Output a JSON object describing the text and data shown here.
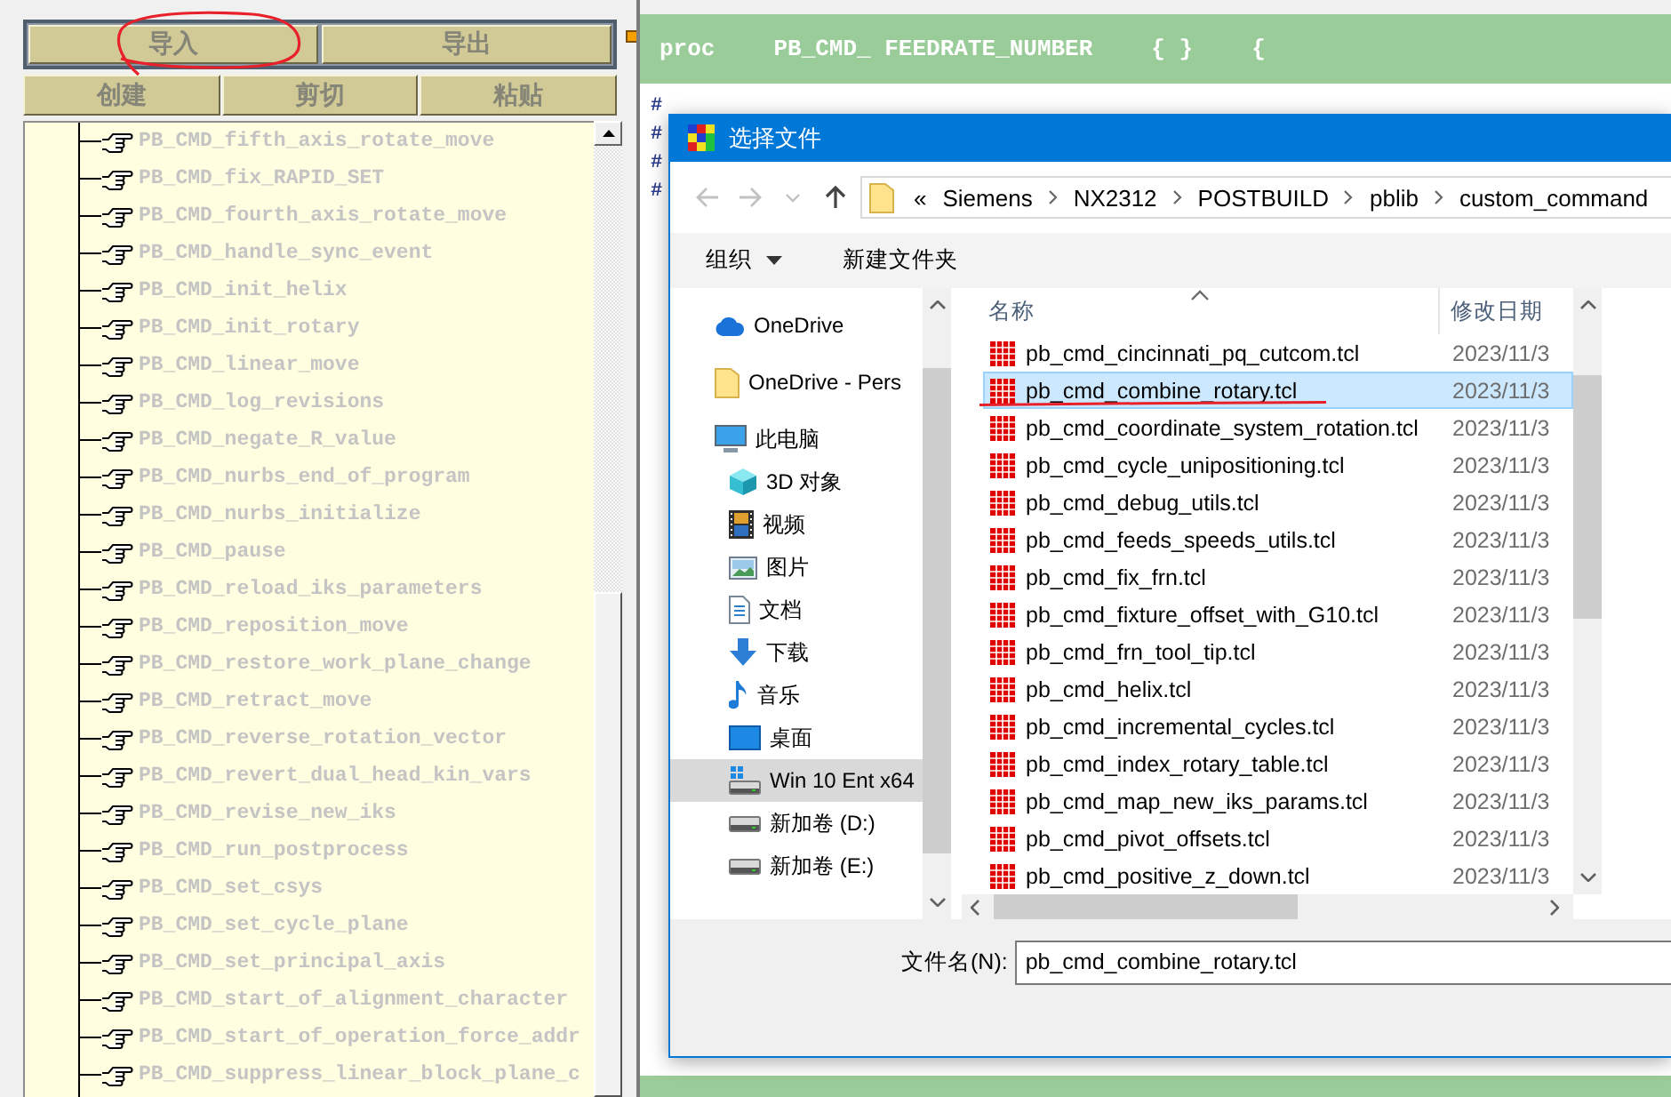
{
  "file_buttons": [
    {
      "label": "导入",
      "disabled": true,
      "marked": true
    },
    {
      "label": "导出",
      "disabled": true,
      "marked": false
    }
  ],
  "edit_buttons": [
    {
      "label": "创建",
      "disabled": true
    },
    {
      "label": "剪切",
      "disabled": true
    },
    {
      "label": "粘贴",
      "disabled": true
    }
  ],
  "command_tree": {
    "items": [
      {
        "label": "PB_CMD_fifth_axis_rotate_move",
        "disabled": true
      },
      {
        "label": "PB_CMD_fix_RAPID_SET",
        "disabled": true
      },
      {
        "label": "PB_CMD_fourth_axis_rotate_move",
        "disabled": true
      },
      {
        "label": "PB_CMD_handle_sync_event",
        "disabled": true
      },
      {
        "label": "PB_CMD_init_helix",
        "disabled": true
      },
      {
        "label": "PB_CMD_init_rotary",
        "disabled": true
      },
      {
        "label": "PB_CMD_linear_move",
        "disabled": true
      },
      {
        "label": "PB_CMD_log_revisions",
        "disabled": true
      },
      {
        "label": "PB_CMD_negate_R_value",
        "disabled": true
      },
      {
        "label": "PB_CMD_nurbs_end_of_program",
        "disabled": true
      },
      {
        "label": "PB_CMD_nurbs_initialize",
        "disabled": true
      },
      {
        "label": "PB_CMD_pause",
        "disabled": true
      },
      {
        "label": "PB_CMD_reload_iks_parameters",
        "disabled": true
      },
      {
        "label": "PB_CMD_reposition_move",
        "disabled": true
      },
      {
        "label": "PB_CMD_restore_work_plane_change",
        "disabled": true
      },
      {
        "label": "PB_CMD_retract_move",
        "disabled": true
      },
      {
        "label": "PB_CMD_reverse_rotation_vector",
        "disabled": true
      },
      {
        "label": "PB_CMD_revert_dual_head_kin_vars",
        "disabled": true
      },
      {
        "label": "PB_CMD_revise_new_iks",
        "disabled": true
      },
      {
        "label": "PB_CMD_run_postprocess",
        "disabled": true
      },
      {
        "label": "PB_CMD_set_csys",
        "disabled": true
      },
      {
        "label": "PB_CMD_set_cycle_plane",
        "disabled": true
      },
      {
        "label": "PB_CMD_set_principal_axis",
        "disabled": true
      },
      {
        "label": "PB_CMD_start_of_alignment_character",
        "disabled": true
      },
      {
        "label": "PB_CMD_start_of_operation_force_addr",
        "disabled": true
      },
      {
        "label": "PB_CMD_suppress_linear_block_plane_c",
        "disabled": true
      }
    ]
  },
  "editor": {
    "header": {
      "keyword": "proc",
      "name": "PB_CMD_ FEEDRATE_NUMBER",
      "args": "{ }",
      "body_open": "{"
    },
    "lines": [
      "#",
      "#",
      "#",
      "#"
    ]
  },
  "dialog": {
    "title": "选择文件",
    "nav_buttons": [
      {
        "kind": "back",
        "disabled": true
      },
      {
        "kind": "forward",
        "disabled": true
      },
      {
        "kind": "recent",
        "disabled": true
      },
      {
        "kind": "up",
        "disabled": false
      }
    ],
    "address": {
      "overflow": "«",
      "segments": [
        "Siemens",
        "NX2312",
        "POSTBUILD",
        "pblib",
        "custom_command"
      ]
    },
    "toolbar": [
      {
        "label": "组织",
        "kind": "menu"
      },
      {
        "label": "新建文件夹",
        "kind": "command"
      }
    ],
    "nav_items": [
      {
        "label": "OneDrive",
        "kind": "cloud",
        "selected": false
      },
      {
        "label": "OneDrive - Pers",
        "kind": "folder",
        "selected": false
      },
      {
        "label": "此电脑",
        "kind": "computer",
        "selected": false,
        "children": [
          {
            "label": "3D 对象",
            "kind": "objects_3d",
            "selected": false
          },
          {
            "label": "视频",
            "kind": "videos",
            "selected": false
          },
          {
            "label": "图片",
            "kind": "pictures",
            "selected": false
          },
          {
            "label": "文档",
            "kind": "documents",
            "selected": false
          },
          {
            "label": "下载",
            "kind": "downloads",
            "selected": false
          },
          {
            "label": "音乐",
            "kind": "music",
            "selected": false
          },
          {
            "label": "桌面",
            "kind": "desktop",
            "selected": false
          },
          {
            "label": "Win 10 Ent x64",
            "kind": "system_drive",
            "selected": true
          },
          {
            "label": "新加卷 (D:)",
            "kind": "drive",
            "selected": false
          },
          {
            "label": "新加卷 (E:)",
            "kind": "drive",
            "selected": false
          }
        ]
      }
    ],
    "columns": [
      {
        "label": "名称",
        "sorted": true
      },
      {
        "label": "修改日期",
        "sorted": false
      }
    ],
    "files": [
      {
        "name": "pb_cmd_cincinnati_pq_cutcom.tcl",
        "date": "2023/11/3",
        "selected": false,
        "marked": false
      },
      {
        "name": "pb_cmd_combine_rotary.tcl",
        "date": "2023/11/3",
        "selected": true,
        "marked": true
      },
      {
        "name": "pb_cmd_coordinate_system_rotation.tcl",
        "date": "2023/11/3",
        "selected": false,
        "marked": false
      },
      {
        "name": "pb_cmd_cycle_unipositioning.tcl",
        "date": "2023/11/3",
        "selected": false,
        "marked": false
      },
      {
        "name": "pb_cmd_debug_utils.tcl",
        "date": "2023/11/3",
        "selected": false,
        "marked": false
      },
      {
        "name": "pb_cmd_feeds_speeds_utils.tcl",
        "date": "2023/11/3",
        "selected": false,
        "marked": false
      },
      {
        "name": "pb_cmd_fix_frn.tcl",
        "date": "2023/11/3",
        "selected": false,
        "marked": false
      },
      {
        "name": "pb_cmd_fixture_offset_with_G10.tcl",
        "date": "2023/11/3",
        "selected": false,
        "marked": false
      },
      {
        "name": "pb_cmd_frn_tool_tip.tcl",
        "date": "2023/11/3",
        "selected": false,
        "marked": false
      },
      {
        "name": "pb_cmd_helix.tcl",
        "date": "2023/11/3",
        "selected": false,
        "marked": false
      },
      {
        "name": "pb_cmd_incremental_cycles.tcl",
        "date": "2023/11/3",
        "selected": false,
        "marked": false
      },
      {
        "name": "pb_cmd_index_rotary_table.tcl",
        "date": "2023/11/3",
        "selected": false,
        "marked": false
      },
      {
        "name": "pb_cmd_map_new_iks_params.tcl",
        "date": "2023/11/3",
        "selected": false,
        "marked": false
      },
      {
        "name": "pb_cmd_pivot_offsets.tcl",
        "date": "2023/11/3",
        "selected": false,
        "marked": false
      },
      {
        "name": "pb_cmd_positive_z_down.tcl",
        "date": "2023/11/3",
        "selected": false,
        "marked": false
      }
    ],
    "file_name": {
      "label": "文件名(N):",
      "value": "pb_cmd_combine_rotary.tcl"
    }
  }
}
